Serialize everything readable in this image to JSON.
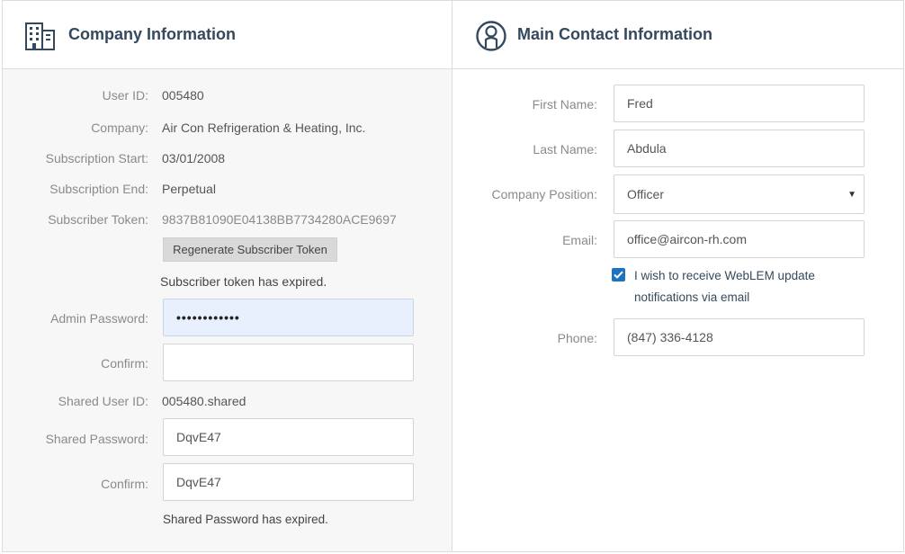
{
  "company_panel": {
    "title": "Company Information",
    "user_id": {
      "label": "User ID:",
      "value": "005480"
    },
    "company": {
      "label": "Company:",
      "value": "Air Con Refrigeration & Heating, Inc."
    },
    "subscription_start": {
      "label": "Subscription Start:",
      "value": "03/01/2008"
    },
    "subscription_end": {
      "label": "Subscription End:",
      "value": "Perpetual"
    },
    "subscriber_token": {
      "label": "Subscriber Token:",
      "value": "9837B81090E04138BB7734280ACE9697"
    },
    "regenerate_button": "Regenerate Subscriber Token",
    "token_message": "Subscriber token has expired.",
    "admin_password": {
      "label": "Admin Password:",
      "value": "••••••••••••"
    },
    "admin_confirm": {
      "label": "Confirm:",
      "value": ""
    },
    "shared_user_id": {
      "label": "Shared User ID:",
      "value": "005480.shared"
    },
    "shared_password": {
      "label": "Shared Password:",
      "value": "DqvE47"
    },
    "shared_confirm": {
      "label": "Confirm:",
      "value": "DqvE47"
    },
    "shared_message": "Shared Password has expired."
  },
  "contact_panel": {
    "title": "Main Contact Information",
    "first_name": {
      "label": "First Name:",
      "value": "Fred"
    },
    "last_name": {
      "label": "Last Name:",
      "value": "Abdula"
    },
    "company_position": {
      "label": "Company Position:",
      "value": "Officer"
    },
    "email": {
      "label": "Email:",
      "value": "office@aircon-rh.com"
    },
    "email_opt_in": {
      "checked": true,
      "label": "I wish to receive WebLEM update notifications via email"
    },
    "phone": {
      "label": "Phone:",
      "value": "(847) 336-4128"
    }
  },
  "colors": {
    "heading": "#34495e",
    "checkbox": "#1e73be",
    "password_fill": "#e8f0fe"
  }
}
